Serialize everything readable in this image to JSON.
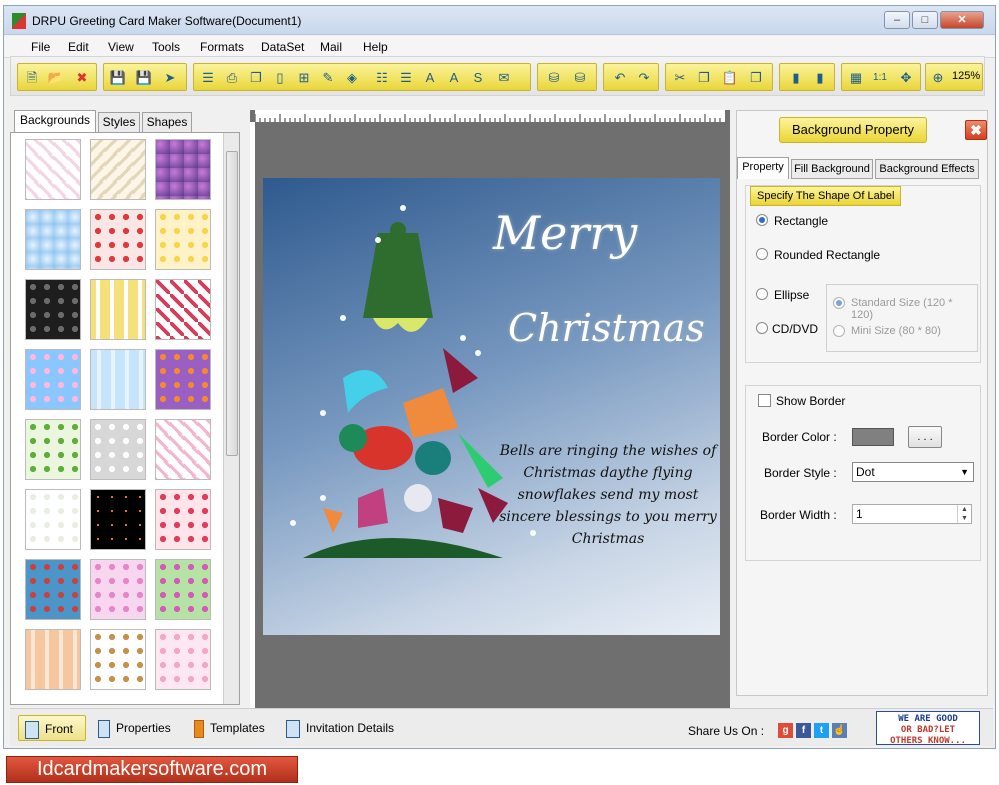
{
  "window": {
    "title": "DRPU Greeting Card Maker Software(Document1)",
    "minimize": "–",
    "restore": "□",
    "close": "✕"
  },
  "menu": [
    "File",
    "Edit",
    "View",
    "Tools",
    "Formats",
    "DataSet",
    "Mail",
    "Help"
  ],
  "toolbar": {
    "zoom": "125%"
  },
  "left_panel": {
    "tabs": [
      "Backgrounds",
      "Styles",
      "Shapes"
    ],
    "active_tab": "Backgrounds"
  },
  "card": {
    "title_line1": "Merry",
    "title_line2": "Christmas",
    "verse": "Bells are ringing the wishes of Christmas daythe flying snowflakes send my most sincere blessings to you merry Christmas"
  },
  "right_panel": {
    "title": "Background Property",
    "close": "✖",
    "tabs": [
      "Property",
      "Fill Background",
      "Background Effects"
    ],
    "shape_group_title": "Specify The Shape Of Label",
    "shapes": [
      "Rectangle",
      "Rounded Rectangle",
      "Ellipse",
      "CD/DVD"
    ],
    "selected_shape": "Rectangle",
    "cd_sizes": [
      "Standard Size (120 * 120)",
      "Mini Size (80 * 80)"
    ],
    "show_border": "Show Border",
    "border_color_label": "Border Color :",
    "border_color_value": "#808080",
    "dots_button": ". . .",
    "border_style_label": "Border Style :",
    "border_style_value": "Dot",
    "border_width_label": "Border Width :",
    "border_width_value": "1"
  },
  "bottom_bar": {
    "front": "Front",
    "properties": "Properties",
    "templates": "Templates",
    "invitation": "Invitation Details",
    "share": "Share Us On :",
    "feedback_line1": "WE ARE GOOD",
    "feedback_line2": "OR BAD?LET",
    "feedback_line3": "OTHERS KNOW..."
  },
  "footer_site": "Idcardmakersoftware.com"
}
